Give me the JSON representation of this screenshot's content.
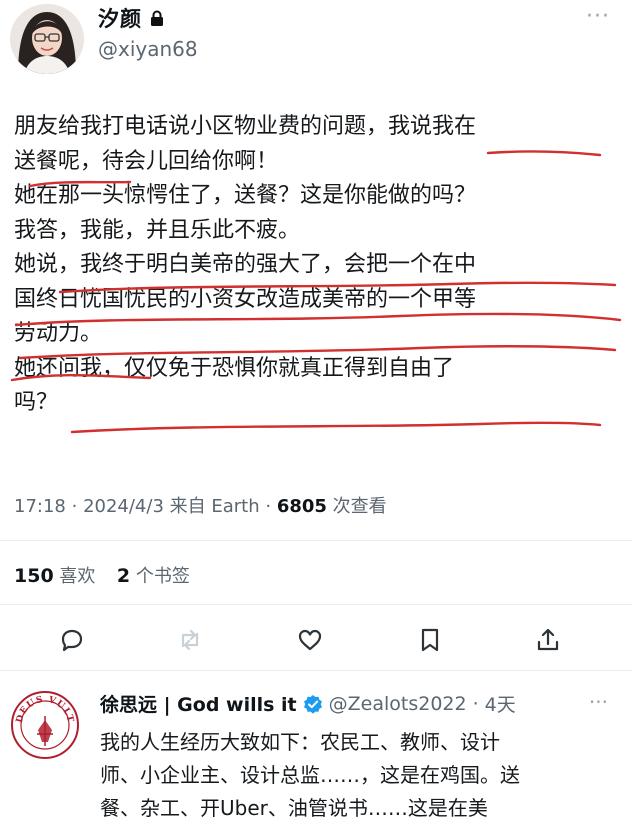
{
  "post": {
    "author_name": "汐颜",
    "handle": "@xiyan68",
    "text_lines": [
      "朋友给我打电话说小区物业费的问题，我说我在",
      "送餐呢，待会儿回给你啊！",
      "她在那一头惊愕住了，送餐？这是你能做的吗？",
      "我答，我能，并且乐此不疲。",
      "她说，我终于明白美帝的强大了，会把一个在中",
      "国终日忧国忧民的小资女改造成美帝的一个甲等",
      "劳动力。",
      "她还问我，仅仅免于恐惧你就真正得到自由了",
      "吗？"
    ],
    "time": "17:18",
    "date": "2024/4/3",
    "source": "来自 Earth",
    "views_count": "6805",
    "views_label": "次查看",
    "likes_count": "150",
    "likes_label": "喜欢",
    "bookmarks_count": "2",
    "bookmarks_label": "个书签",
    "underline_color": "#d0302f"
  },
  "reply": {
    "name": "徐思远 | God wills it",
    "handle": "@Zealots2022",
    "time_ago": "4天",
    "text_lines": [
      "我的人生经历大致如下：农民工、教师、设计",
      "师、小企业主、设计总监……，这是在鸡国。送",
      "餐、杂工、开Uber、油管说书……这是在美"
    ],
    "avatar_text": "DEUS VULT"
  }
}
